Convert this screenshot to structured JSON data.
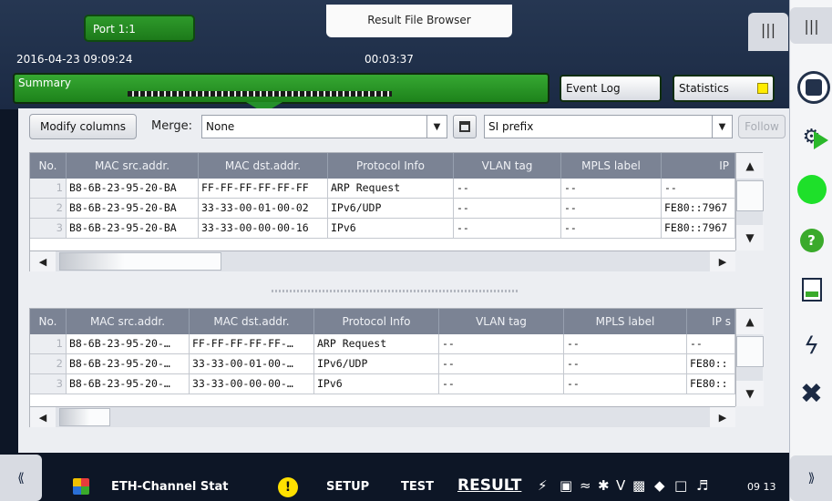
{
  "header": {
    "port_tab": "Port 1:1",
    "title_tab": "Result File Browser",
    "datetime": "2016-04-23 09:09:24",
    "elapsed": "00:03:37",
    "summary_label": "Summary",
    "event_log": "Event Log",
    "statistics": "Statistics",
    "menu_glyph": "|||"
  },
  "toolbar": {
    "modify_columns": "Modify columns",
    "merge_label": "Merge:",
    "merge_value": "None",
    "prefix_value": "SI prefix",
    "follow": "Follow"
  },
  "table_top": {
    "columns": [
      "No.",
      "MAC src.addr.",
      "MAC dst.addr.",
      "Protocol Info",
      "VLAN tag",
      "MPLS label",
      "IP"
    ],
    "rows": [
      [
        "1",
        "B8-6B-23-95-20-BA",
        "FF-FF-FF-FF-FF-FF",
        "ARP Request",
        "--",
        "--",
        "--"
      ],
      [
        "2",
        "B8-6B-23-95-20-BA",
        "33-33-00-01-00-02",
        "IPv6/UDP",
        "--",
        "--",
        "FE80::7967"
      ],
      [
        "3",
        "B8-6B-23-95-20-BA",
        "33-33-00-00-00-16",
        "IPv6",
        "--",
        "--",
        "FE80::7967"
      ]
    ]
  },
  "table_bottom": {
    "columns": [
      "No.",
      "MAC src.addr.",
      "MAC dst.addr.",
      "Protocol Info",
      "VLAN tag",
      "MPLS label",
      "IP s"
    ],
    "rows": [
      [
        "1",
        "B8-6B-23-95-20-…",
        "FF-FF-FF-FF-FF-…",
        "ARP Request",
        "--",
        "--",
        "--"
      ],
      [
        "2",
        "B8-6B-23-95-20-…",
        "33-33-00-01-00-…",
        "IPv6/UDP",
        "--",
        "--",
        "FE80::"
      ],
      [
        "3",
        "B8-6B-23-95-20-…",
        "33-33-00-00-00-…",
        "IPv6",
        "--",
        "--",
        "FE80::"
      ]
    ]
  },
  "right_rail": {
    "menu_glyph": "|||",
    "help": "?",
    "close": "✖",
    "bolt": "ϟ",
    "next": "⟫"
  },
  "bottom_bar": {
    "prev": "⟪",
    "app_name": "ETH-Channel Stat",
    "warning": "!",
    "setup": "SETUP",
    "test": "TEST",
    "result": "RESULT",
    "time": "09 13"
  },
  "icons": {
    "stop": "stop-icon",
    "traffic": "traffic-light-icon",
    "status": "green-status-icon",
    "help": "help-icon",
    "report": "report-icon",
    "bolt": "lightning-icon",
    "close": "close-icon"
  },
  "colors": {
    "accent_green": "#2e9a2b",
    "header_bg": "#1b2a44",
    "table_header": "#7b8394",
    "indicator_yellow": "#ffec00"
  }
}
